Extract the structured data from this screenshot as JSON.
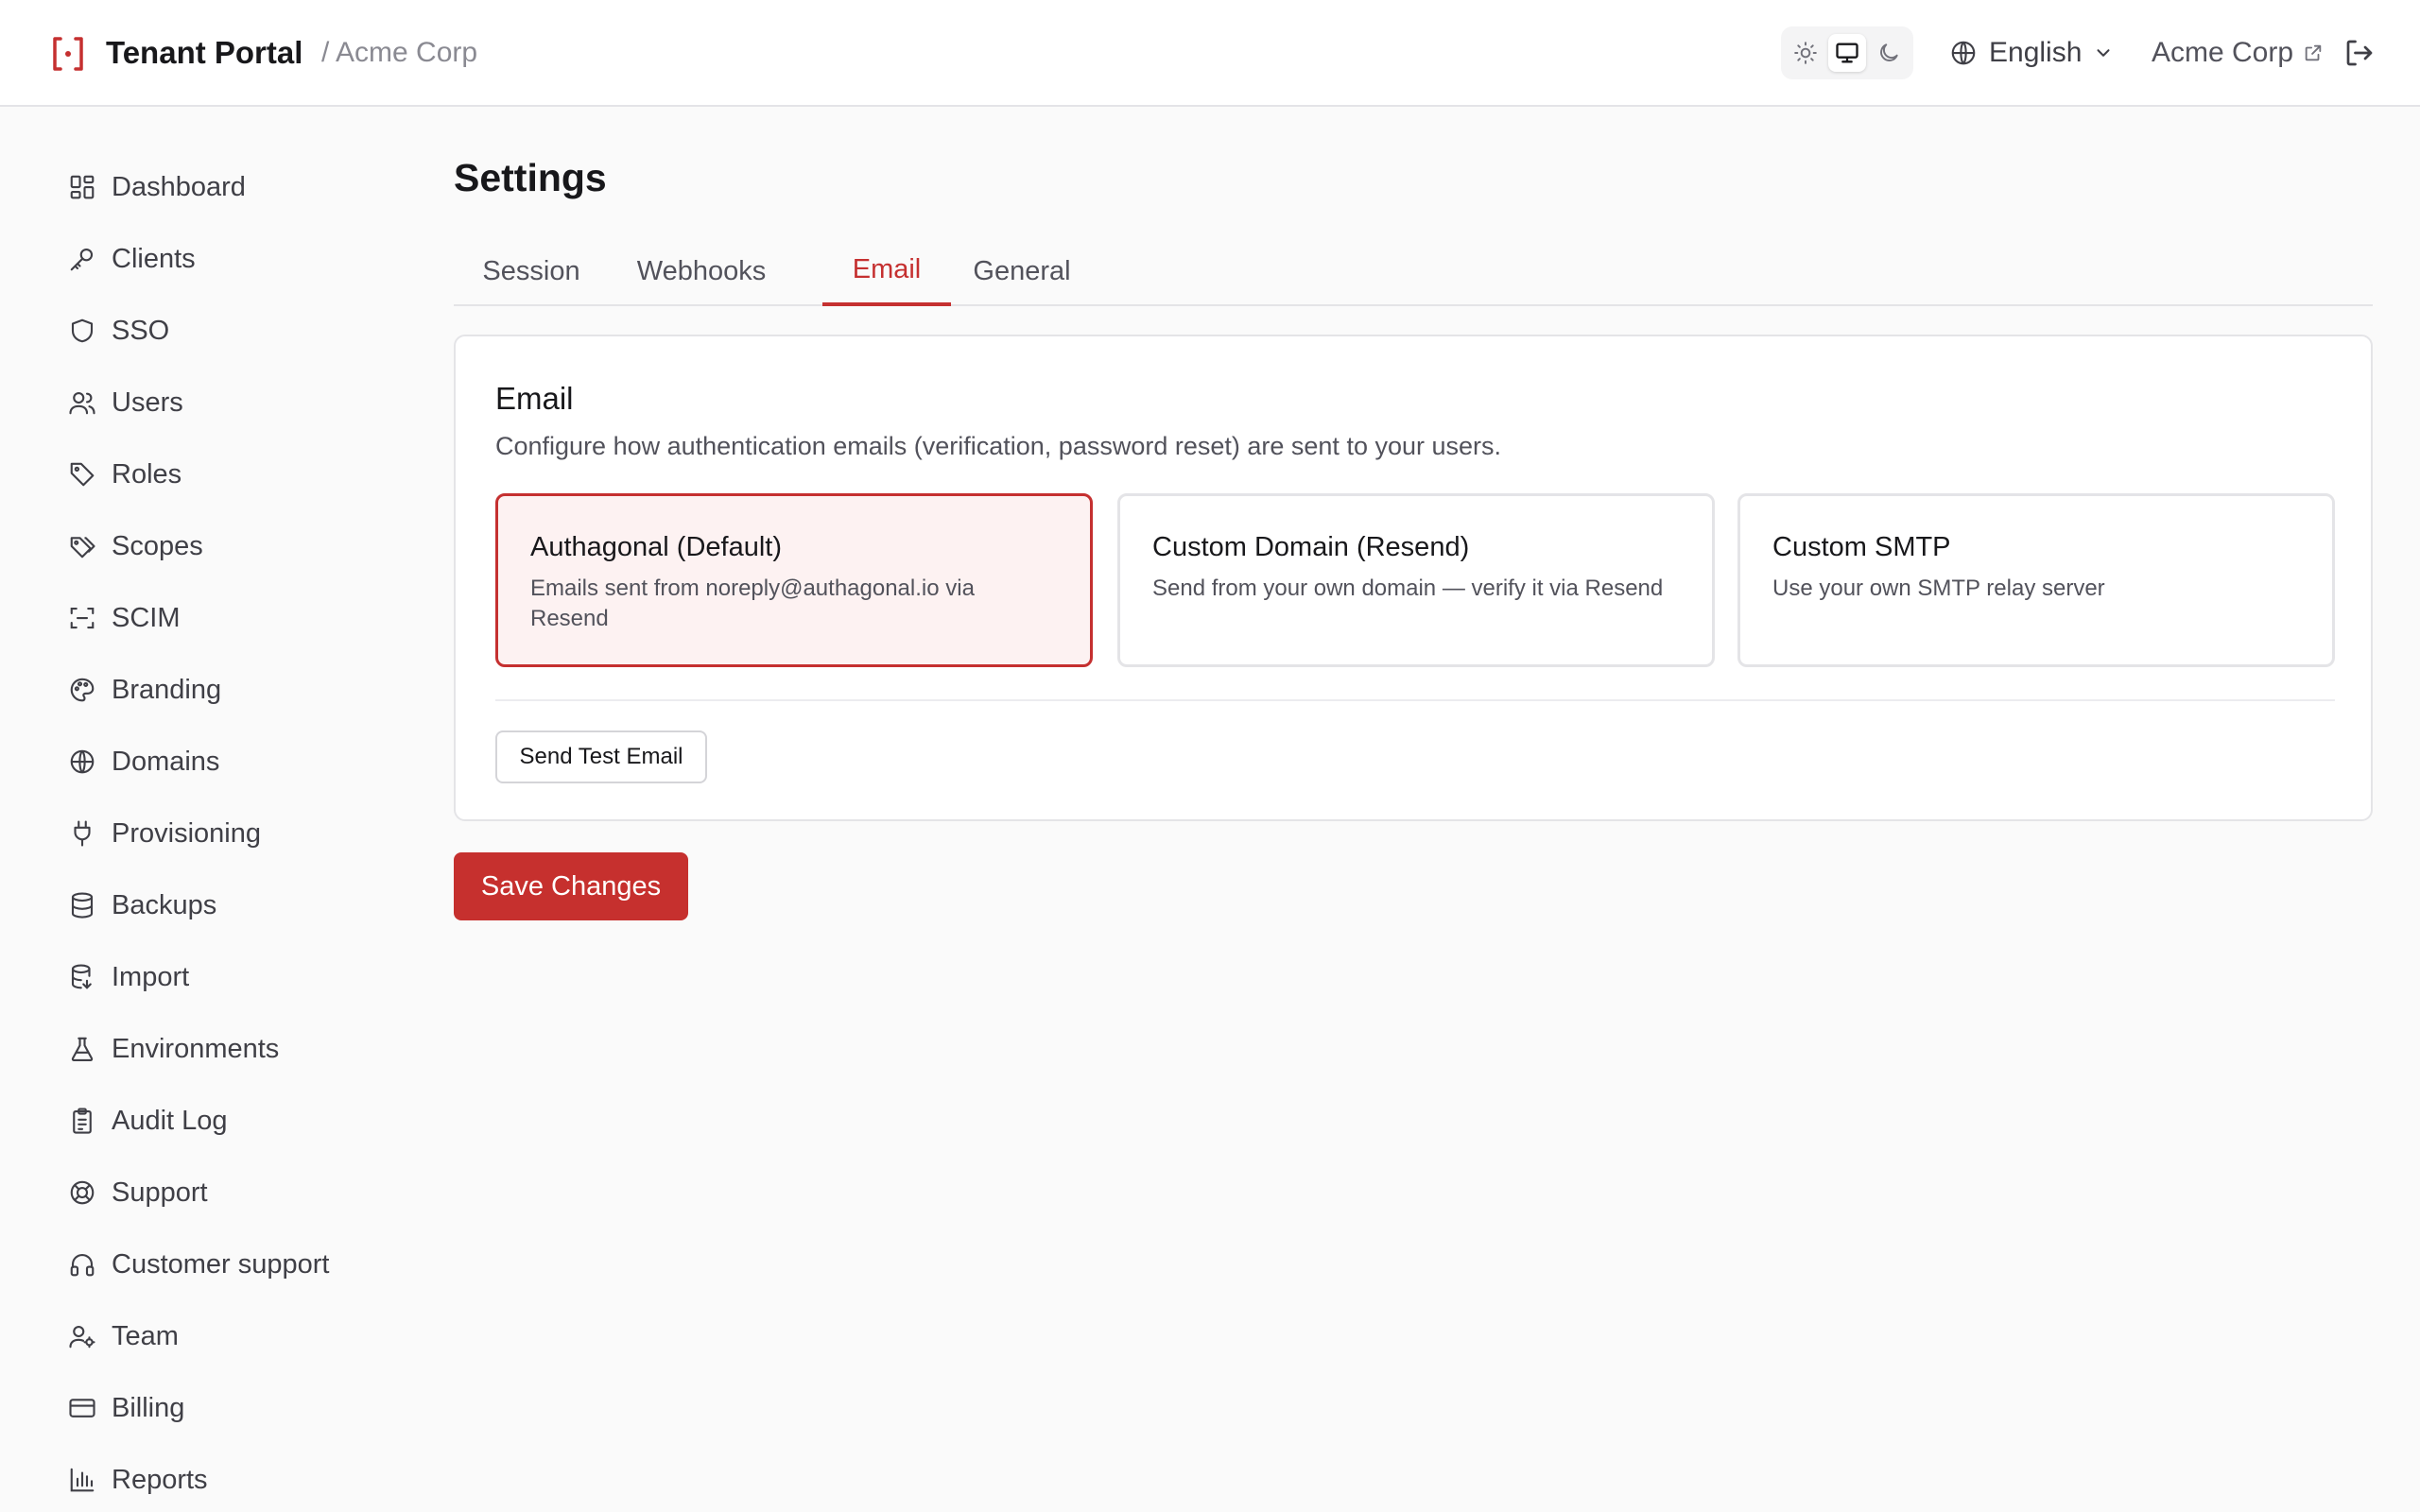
{
  "header": {
    "title": "Tenant Portal",
    "breadcrumb": "/ Acme Corp",
    "language": "English",
    "tenant": "Acme Corp",
    "accent": "#c53030"
  },
  "theme_toggle": {
    "options": [
      "light",
      "system",
      "dark"
    ],
    "selected": "system"
  },
  "sidebar": {
    "items": [
      {
        "label": "Dashboard",
        "icon": "dashboard-icon"
      },
      {
        "label": "Clients",
        "icon": "key-icon"
      },
      {
        "label": "SSO",
        "icon": "shield-icon"
      },
      {
        "label": "Users",
        "icon": "users-icon"
      },
      {
        "label": "Roles",
        "icon": "tag-icon"
      },
      {
        "label": "Scopes",
        "icon": "tags-icon"
      },
      {
        "label": "SCIM",
        "icon": "scan-icon"
      },
      {
        "label": "Branding",
        "icon": "palette-icon"
      },
      {
        "label": "Domains",
        "icon": "globe-icon"
      },
      {
        "label": "Provisioning",
        "icon": "plug-icon"
      },
      {
        "label": "Backups",
        "icon": "database-icon"
      },
      {
        "label": "Import",
        "icon": "database-import-icon"
      },
      {
        "label": "Environments",
        "icon": "flask-icon"
      },
      {
        "label": "Audit Log",
        "icon": "clipboard-icon"
      },
      {
        "label": "Support",
        "icon": "lifebuoy-icon"
      },
      {
        "label": "Customer support",
        "icon": "headphones-icon"
      },
      {
        "label": "Team",
        "icon": "user-cog-icon"
      },
      {
        "label": "Billing",
        "icon": "credit-card-icon"
      },
      {
        "label": "Reports",
        "icon": "bar-chart-icon"
      }
    ]
  },
  "main": {
    "title": "Settings",
    "tabs": [
      {
        "label": "Session"
      },
      {
        "label": "Webhooks"
      },
      {
        "label": "Email"
      },
      {
        "label": "General"
      }
    ],
    "active_tab": "Email",
    "card": {
      "title": "Email",
      "description": "Configure how authentication emails (verification, password reset) are sent to your users.",
      "options": [
        {
          "title": "Authagonal (Default)",
          "description": "Emails sent from noreply@authagonal.io via Resend"
        },
        {
          "title": "Custom Domain (Resend)",
          "description": "Send from your own domain — verify it via Resend"
        },
        {
          "title": "Custom SMTP",
          "description": "Use your own SMTP relay server"
        }
      ],
      "selected_option": "Authagonal (Default)",
      "test_button": "Send Test Email"
    },
    "save_button": "Save Changes"
  }
}
